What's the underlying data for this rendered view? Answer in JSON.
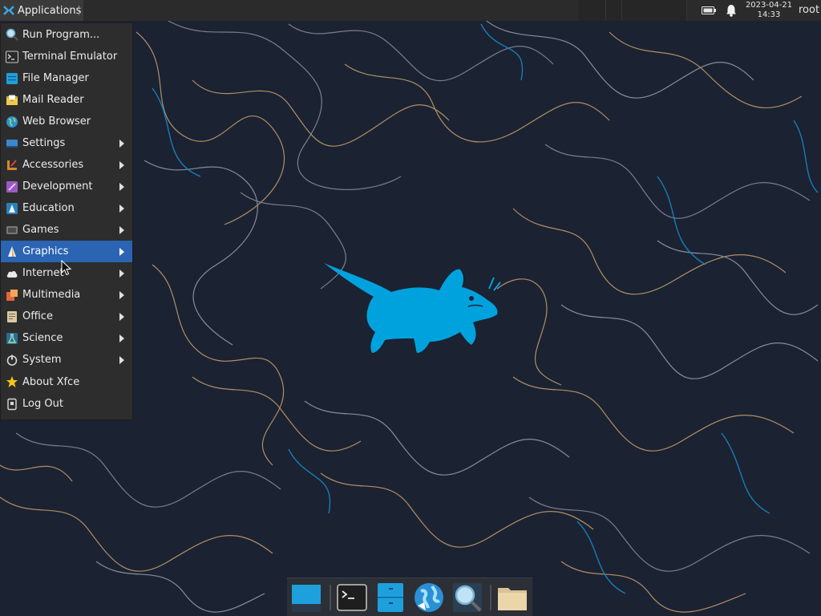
{
  "top_panel": {
    "apps_label": "Applications",
    "clock_date": "2023-04-21",
    "clock_time": "14:33",
    "user": "root",
    "tray_icons": [
      "battery-icon",
      "bell-icon"
    ]
  },
  "menu": {
    "items": [
      {
        "label": "Run Program...",
        "icon": "search-icon",
        "submenu": false
      },
      {
        "label": "Terminal Emulator",
        "icon": "terminal-icon",
        "submenu": false
      },
      {
        "label": "File Manager",
        "icon": "file-manager-icon",
        "submenu": false
      },
      {
        "label": "Mail Reader",
        "icon": "mail-icon",
        "submenu": false
      },
      {
        "label": "Web Browser",
        "icon": "globe-icon",
        "submenu": false
      },
      {
        "label": "Settings",
        "icon": "settings-icon",
        "submenu": true
      },
      {
        "label": "Accessories",
        "icon": "accessories-icon",
        "submenu": true
      },
      {
        "label": "Development",
        "icon": "development-icon",
        "submenu": true
      },
      {
        "label": "Education",
        "icon": "education-icon",
        "submenu": true
      },
      {
        "label": "Games",
        "icon": "games-icon",
        "submenu": true
      },
      {
        "label": "Graphics",
        "icon": "graphics-icon",
        "submenu": true,
        "active": true
      },
      {
        "label": "Internet",
        "icon": "cloud-icon",
        "submenu": true
      },
      {
        "label": "Multimedia",
        "icon": "multimedia-icon",
        "submenu": true
      },
      {
        "label": "Office",
        "icon": "office-icon",
        "submenu": true
      },
      {
        "label": "Science",
        "icon": "science-icon",
        "submenu": true
      },
      {
        "label": "System",
        "icon": "power-icon",
        "submenu": true
      },
      {
        "label": "About Xfce",
        "icon": "star-icon",
        "submenu": false
      },
      {
        "label": "Log Out",
        "icon": "logout-icon",
        "submenu": false
      }
    ]
  },
  "dock": {
    "items": [
      "show-desktop-icon",
      "terminal-icon",
      "file-manager-icon",
      "web-browser-icon",
      "app-finder-icon",
      "folder-icon"
    ]
  },
  "colors": {
    "accent": "#2a64b3",
    "mouse_blue": "#00a2de",
    "wallpaper": "#1b2232"
  }
}
